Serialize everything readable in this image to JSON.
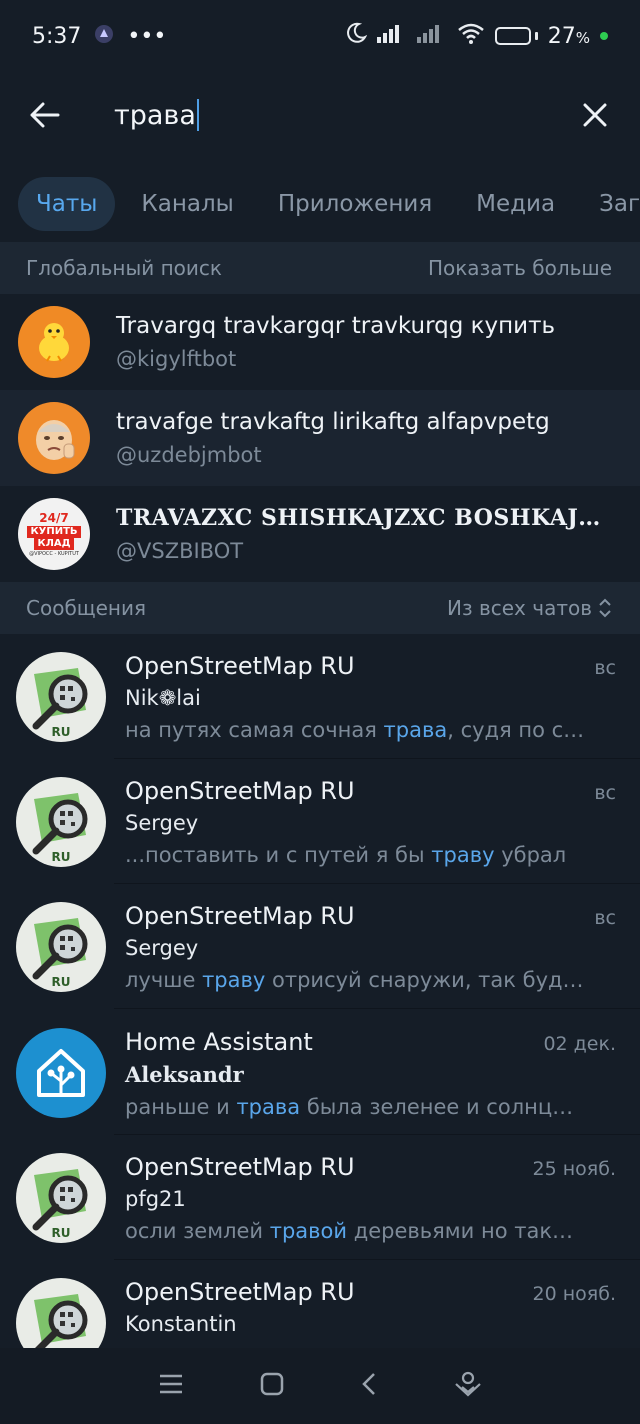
{
  "status": {
    "time": "5:37",
    "dots": "•••",
    "battery": "27",
    "battery_unit": "%",
    "battery_level": 0.27
  },
  "search": {
    "query": "трава"
  },
  "tabs": [
    {
      "label": "Чаты",
      "active": true
    },
    {
      "label": "Каналы"
    },
    {
      "label": "Приложения"
    },
    {
      "label": "Медиа"
    },
    {
      "label": "Загрузки"
    }
  ],
  "global": {
    "title": "Глобальный поиск",
    "action": "Показать больше"
  },
  "bots": [
    {
      "name": "Travargq travkargqr travkurqg купить",
      "username": "@kigylftbot"
    },
    {
      "name": "travafge travkaftg lirikaftg alfapvpetg",
      "username": "@uzdebjmbot"
    },
    {
      "name": "TRAVAZXC SHISHKAJZXC BOSHKAJ…",
      "username": "@VSZBIBOT",
      "avatar_lines": [
        "24/7",
        "КУПИТЬ",
        "КЛАД",
        "@VIPOCC - KUPITUT"
      ]
    }
  ],
  "messages_head": {
    "title": "Сообщения",
    "filter": "Из всех чатов"
  },
  "messages": [
    {
      "chat": "OpenStreetMap RU",
      "date": "вс",
      "sender": "Nik❁lai",
      "pre": "на путях самая сочная ",
      "hl": "трава",
      "post": ", судя по с…",
      "avatar_label": "RU"
    },
    {
      "chat": "OpenStreetMap RU",
      "date": "вс",
      "sender": "Sergey",
      "pre": "...поставить и с путей я бы ",
      "hl": "траву",
      "post": " убрал",
      "avatar_label": "RU"
    },
    {
      "chat": "OpenStreetMap RU",
      "date": "вс",
      "sender": "Sergey",
      "pre": "лучше ",
      "hl": "траву",
      "post": " отрисуй снаружи, так буд…",
      "avatar_label": "RU"
    },
    {
      "chat": "Home Assistant",
      "date": "02 дек.",
      "sender": "Aleksandr",
      "pre": "раньше и ",
      "hl": "трава",
      "post": " была зеленее и солнц…",
      "avatar_label": ""
    },
    {
      "chat": "OpenStreetMap RU",
      "date": "25 нояб.",
      "sender": "pfg21",
      "pre": "осли землей ",
      "hl": "травой",
      "post": " деревьями но так…",
      "avatar_label": "RU"
    },
    {
      "chat": "OpenStreetMap RU",
      "date": "20 нояб.",
      "sender": "Konstantin",
      "pre": "",
      "hl": "",
      "post": "",
      "avatar_label": "RU"
    }
  ],
  "colors": {
    "background": "#151d27",
    "accent": "#5aa6ea",
    "section": "#1d2733"
  }
}
